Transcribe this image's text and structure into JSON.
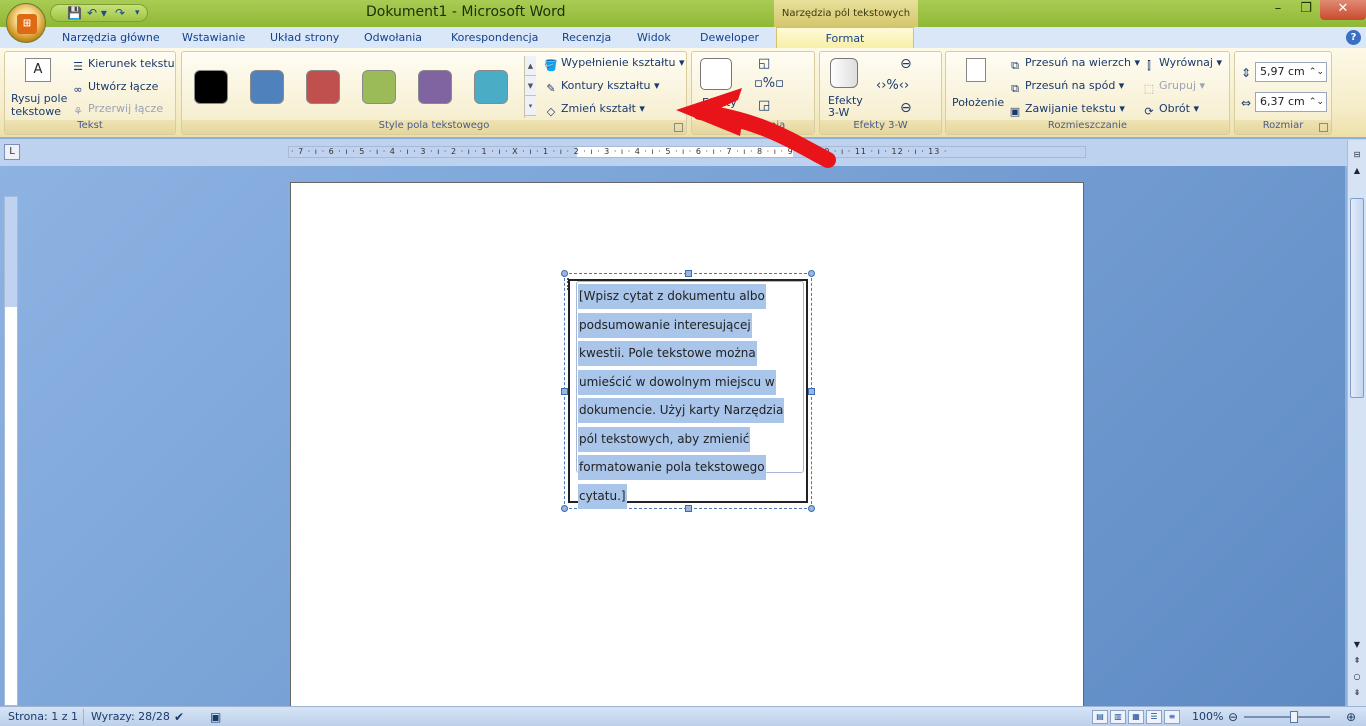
{
  "window": {
    "title": "Dokument1 - Microsoft Word",
    "context_tab_group": "Narzędzia pól tekstowych",
    "office_button": "Office",
    "minimize": "–",
    "maximize": "❐",
    "close": "✕"
  },
  "qat": {
    "save": "💾",
    "undo": "↶ ▾",
    "redo": "↷",
    "more": "▾"
  },
  "tabs": [
    "Narzędzia główne",
    "Wstawianie",
    "Układ strony",
    "Odwołania",
    "Korespondencja",
    "Recenzja",
    "Widok",
    "Deweloper",
    "Format"
  ],
  "ribbon": {
    "tekst": {
      "label": "Tekst",
      "draw_btn": "Rysuj pole",
      "draw_btn_2": "tekstowe",
      "direction": "Kierunek tekstu",
      "create_link": "Utwórz łącze",
      "break_link": "Przerwij łącze"
    },
    "styles": {
      "label": "Style pola tekstowego",
      "swatch_colors": [
        "#000000",
        "#4f81bd",
        "#c0504d",
        "#9bbb59",
        "#8064a2",
        "#4bacc6"
      ],
      "fill": "Wypełnienie kształtu",
      "outline": "Kontury kształtu",
      "change_shape": "Zmień kształt"
    },
    "shadow": {
      "label": "Efekty cienia",
      "btn": "Efekty"
    },
    "effects3d": {
      "label": "Efekty 3-W",
      "btn": "Efekty",
      "btn_2": "3-W"
    },
    "arrange": {
      "label": "Rozmieszczanie",
      "position": "Położenie",
      "bring_front": "Przesuń na wierzch",
      "send_back": "Przesuń na spód",
      "wrap": "Zawijanie tekstu",
      "align": "Wyrównaj",
      "group": "Grupuj",
      "rotate": "Obrót"
    },
    "size": {
      "label": "Rozmiar",
      "height": "5,97 cm",
      "width": "6,37 cm"
    }
  },
  "ruler": {
    "numbers": "· 7 · ı · 6 · ı · 5 · ı · 4 · ı · 3 · ı · 2 · ı · 1 · ı · X · ı · 1 · ı · 2 · ı · 3 · ı · 4 · ı · 5 · ı · 6 · ı · 7 · ı · 8 · ı · 9 · ı · 10 · ı · 11 · ı · 12 · ı · 13 ·"
  },
  "textbox": {
    "lines": [
      "[Wpisz cytat z dokumentu albo",
      "podsumowanie interesującej",
      "kwestii. Pole tekstowe można",
      "umieścić w dowolnym miejscu w",
      "dokumencie. Użyj karty Narzędzia",
      "pól tekstowych, aby zmienić",
      "formatowanie pola tekstowego",
      "cytatu.]"
    ]
  },
  "status": {
    "page": "Strona: 1 z 1",
    "words": "Wyrazy: 28/28",
    "zoom": "100%"
  },
  "annotation_color": "#e8141a"
}
